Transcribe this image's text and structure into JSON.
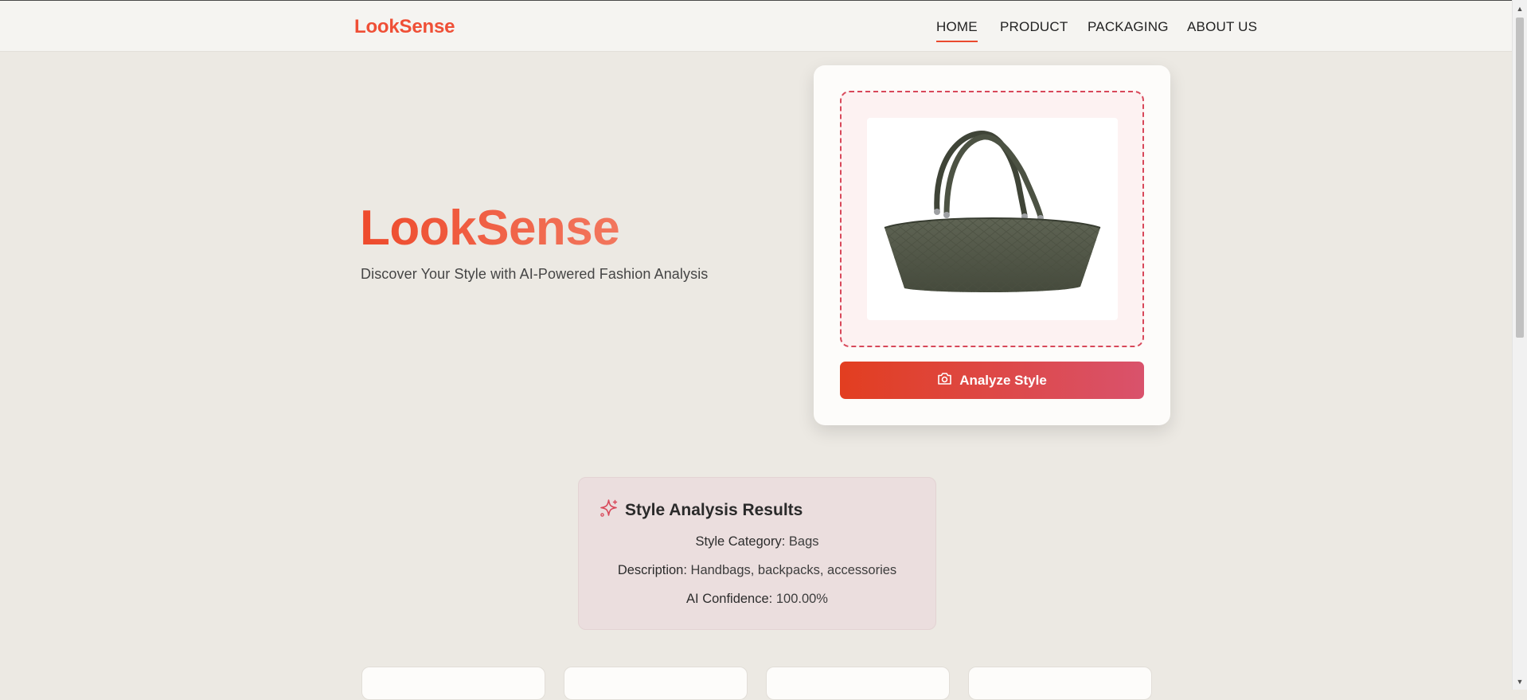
{
  "nav": {
    "brand": "LookSense",
    "items": [
      {
        "label": "HOME",
        "active": true
      },
      {
        "label": "PRODUCT",
        "active": false
      },
      {
        "label": "PACKAGING",
        "active": false
      },
      {
        "label": "ABOUT US",
        "active": false
      }
    ]
  },
  "hero": {
    "title": "LookSense",
    "subtitle": "Discover Your Style with AI-Powered Fashion Analysis"
  },
  "upload": {
    "preview_image": "quilted olive green handbag",
    "analyze_button": {
      "icon": "camera-icon",
      "label": "Analyze Style"
    }
  },
  "results": {
    "icon": "sparkle-icon",
    "title": "Style Analysis Results",
    "lines": [
      {
        "label": "Style Category:",
        "value": "Bags"
      },
      {
        "label": "Description:",
        "value": "Handbags, backpacks, accessories"
      },
      {
        "label": "AI Confidence:",
        "value": "100.00%"
      }
    ]
  },
  "colors": {
    "accent": "#ef4f36",
    "button_gradient_start": "#e23e20",
    "button_gradient_end": "#d9526c",
    "page_background": "#ece9e3",
    "results_background": "#ebdede"
  }
}
